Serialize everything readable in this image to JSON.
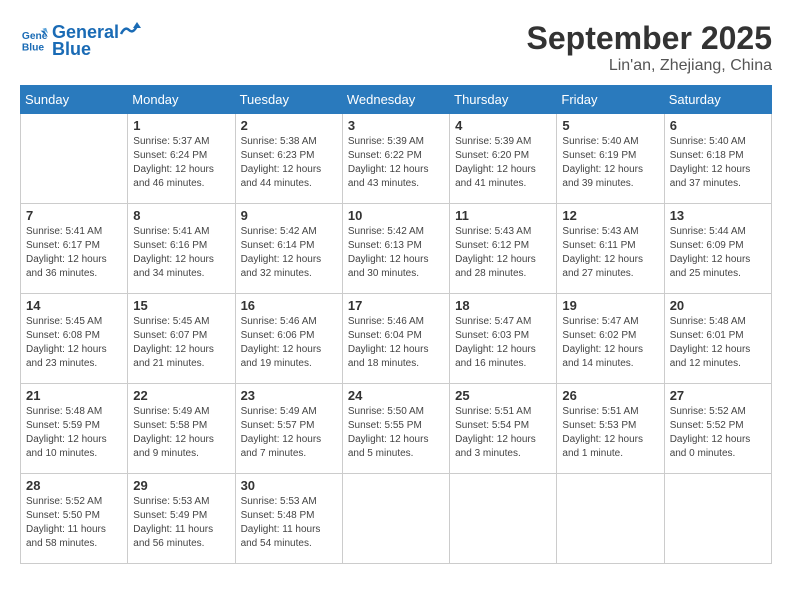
{
  "logo": {
    "line1": "General",
    "line2": "Blue"
  },
  "header": {
    "month": "September 2025",
    "location": "Lin'an, Zhejiang, China"
  },
  "weekdays": [
    "Sunday",
    "Monday",
    "Tuesday",
    "Wednesday",
    "Thursday",
    "Friday",
    "Saturday"
  ],
  "weeks": [
    [
      {
        "day": "",
        "info": ""
      },
      {
        "day": "1",
        "info": "Sunrise: 5:37 AM\nSunset: 6:24 PM\nDaylight: 12 hours\nand 46 minutes."
      },
      {
        "day": "2",
        "info": "Sunrise: 5:38 AM\nSunset: 6:23 PM\nDaylight: 12 hours\nand 44 minutes."
      },
      {
        "day": "3",
        "info": "Sunrise: 5:39 AM\nSunset: 6:22 PM\nDaylight: 12 hours\nand 43 minutes."
      },
      {
        "day": "4",
        "info": "Sunrise: 5:39 AM\nSunset: 6:20 PM\nDaylight: 12 hours\nand 41 minutes."
      },
      {
        "day": "5",
        "info": "Sunrise: 5:40 AM\nSunset: 6:19 PM\nDaylight: 12 hours\nand 39 minutes."
      },
      {
        "day": "6",
        "info": "Sunrise: 5:40 AM\nSunset: 6:18 PM\nDaylight: 12 hours\nand 37 minutes."
      }
    ],
    [
      {
        "day": "7",
        "info": "Sunrise: 5:41 AM\nSunset: 6:17 PM\nDaylight: 12 hours\nand 36 minutes."
      },
      {
        "day": "8",
        "info": "Sunrise: 5:41 AM\nSunset: 6:16 PM\nDaylight: 12 hours\nand 34 minutes."
      },
      {
        "day": "9",
        "info": "Sunrise: 5:42 AM\nSunset: 6:14 PM\nDaylight: 12 hours\nand 32 minutes."
      },
      {
        "day": "10",
        "info": "Sunrise: 5:42 AM\nSunset: 6:13 PM\nDaylight: 12 hours\nand 30 minutes."
      },
      {
        "day": "11",
        "info": "Sunrise: 5:43 AM\nSunset: 6:12 PM\nDaylight: 12 hours\nand 28 minutes."
      },
      {
        "day": "12",
        "info": "Sunrise: 5:43 AM\nSunset: 6:11 PM\nDaylight: 12 hours\nand 27 minutes."
      },
      {
        "day": "13",
        "info": "Sunrise: 5:44 AM\nSunset: 6:09 PM\nDaylight: 12 hours\nand 25 minutes."
      }
    ],
    [
      {
        "day": "14",
        "info": "Sunrise: 5:45 AM\nSunset: 6:08 PM\nDaylight: 12 hours\nand 23 minutes."
      },
      {
        "day": "15",
        "info": "Sunrise: 5:45 AM\nSunset: 6:07 PM\nDaylight: 12 hours\nand 21 minutes."
      },
      {
        "day": "16",
        "info": "Sunrise: 5:46 AM\nSunset: 6:06 PM\nDaylight: 12 hours\nand 19 minutes."
      },
      {
        "day": "17",
        "info": "Sunrise: 5:46 AM\nSunset: 6:04 PM\nDaylight: 12 hours\nand 18 minutes."
      },
      {
        "day": "18",
        "info": "Sunrise: 5:47 AM\nSunset: 6:03 PM\nDaylight: 12 hours\nand 16 minutes."
      },
      {
        "day": "19",
        "info": "Sunrise: 5:47 AM\nSunset: 6:02 PM\nDaylight: 12 hours\nand 14 minutes."
      },
      {
        "day": "20",
        "info": "Sunrise: 5:48 AM\nSunset: 6:01 PM\nDaylight: 12 hours\nand 12 minutes."
      }
    ],
    [
      {
        "day": "21",
        "info": "Sunrise: 5:48 AM\nSunset: 5:59 PM\nDaylight: 12 hours\nand 10 minutes."
      },
      {
        "day": "22",
        "info": "Sunrise: 5:49 AM\nSunset: 5:58 PM\nDaylight: 12 hours\nand 9 minutes."
      },
      {
        "day": "23",
        "info": "Sunrise: 5:49 AM\nSunset: 5:57 PM\nDaylight: 12 hours\nand 7 minutes."
      },
      {
        "day": "24",
        "info": "Sunrise: 5:50 AM\nSunset: 5:55 PM\nDaylight: 12 hours\nand 5 minutes."
      },
      {
        "day": "25",
        "info": "Sunrise: 5:51 AM\nSunset: 5:54 PM\nDaylight: 12 hours\nand 3 minutes."
      },
      {
        "day": "26",
        "info": "Sunrise: 5:51 AM\nSunset: 5:53 PM\nDaylight: 12 hours\nand 1 minute."
      },
      {
        "day": "27",
        "info": "Sunrise: 5:52 AM\nSunset: 5:52 PM\nDaylight: 12 hours\nand 0 minutes."
      }
    ],
    [
      {
        "day": "28",
        "info": "Sunrise: 5:52 AM\nSunset: 5:50 PM\nDaylight: 11 hours\nand 58 minutes."
      },
      {
        "day": "29",
        "info": "Sunrise: 5:53 AM\nSunset: 5:49 PM\nDaylight: 11 hours\nand 56 minutes."
      },
      {
        "day": "30",
        "info": "Sunrise: 5:53 AM\nSunset: 5:48 PM\nDaylight: 11 hours\nand 54 minutes."
      },
      {
        "day": "",
        "info": ""
      },
      {
        "day": "",
        "info": ""
      },
      {
        "day": "",
        "info": ""
      },
      {
        "day": "",
        "info": ""
      }
    ]
  ]
}
